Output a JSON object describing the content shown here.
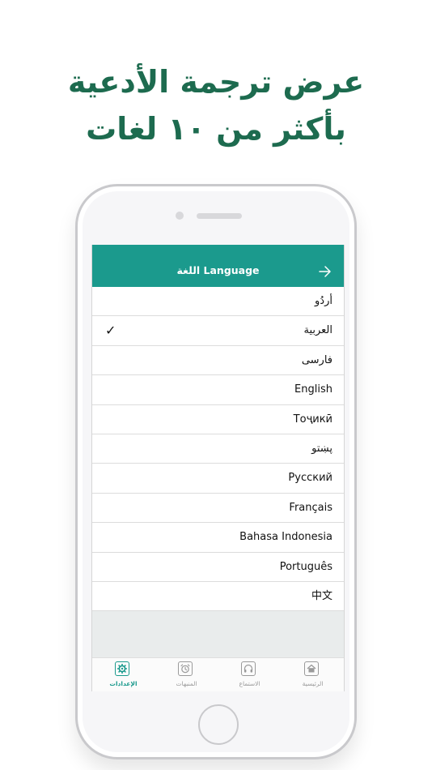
{
  "headline": {
    "line1": "عرض ترجمة الأدعية",
    "line2": "بأكثر من ١٠ لغات"
  },
  "nav": {
    "title": "اللغة Language",
    "back_icon": "arrow-right-icon"
  },
  "languages": [
    {
      "label": "أردُو",
      "selected": false
    },
    {
      "label": "العربية",
      "selected": true,
      "check": "✓"
    },
    {
      "label": "فارسی",
      "selected": false
    },
    {
      "label": "English",
      "selected": false
    },
    {
      "label": "Тоҷикӣ",
      "selected": false
    },
    {
      "label": "پښتو",
      "selected": false
    },
    {
      "label": "Русский",
      "selected": false
    },
    {
      "label": "Français",
      "selected": false
    },
    {
      "label": "Bahasa Indonesia",
      "selected": false
    },
    {
      "label": "Português",
      "selected": false
    },
    {
      "label": "中文",
      "selected": false
    }
  ],
  "tabs": [
    {
      "label": "الإعدادات",
      "icon": "gear-icon",
      "active": true
    },
    {
      "label": "المنبهات",
      "icon": "alarm-clock-icon",
      "active": false
    },
    {
      "label": "الاستماع",
      "icon": "headphones-icon",
      "active": false
    },
    {
      "label": "الرئيسية",
      "icon": "home-icon",
      "active": false
    }
  ],
  "colors": {
    "accent": "#1b9a8d",
    "headline": "#1d6b4f"
  }
}
